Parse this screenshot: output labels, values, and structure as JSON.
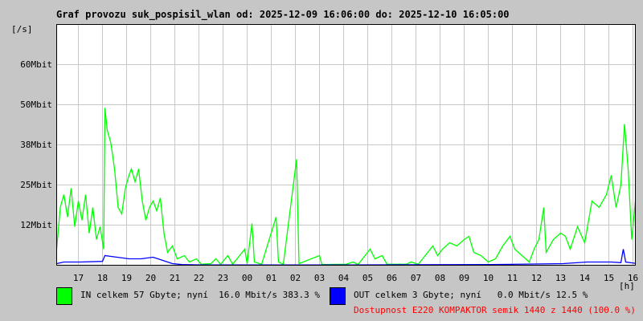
{
  "chart_data": {
    "type": "line",
    "title": "Graf provozu suk_pospisil_wlan od: 2025-12-09 16:06:00 do: 2025-12-10 16:05:00",
    "ylabel": "[/s]",
    "xlabel": "[h]",
    "ylim": [
      0,
      75
    ],
    "xlim_hours": [
      0,
      24
    ],
    "y_ticks": [
      {
        "v": 12.5,
        "label": "12Mbit"
      },
      {
        "v": 25,
        "label": "25Mbit"
      },
      {
        "v": 37.5,
        "label": "38Mbit"
      },
      {
        "v": 50,
        "label": "50Mbit"
      },
      {
        "v": 62.5,
        "label": "60Mbit"
      }
    ],
    "x_tick_labels": [
      "17",
      "18",
      "19",
      "20",
      "21",
      "22",
      "23",
      "00",
      "01",
      "02",
      "03",
      "04",
      "05",
      "06",
      "07",
      "08",
      "09",
      "10",
      "11",
      "12",
      "13",
      "14",
      "15",
      "16"
    ],
    "grid": true,
    "series": [
      {
        "name": "IN",
        "color": "#00ff00",
        "points": [
          [
            0,
            5
          ],
          [
            0.15,
            18
          ],
          [
            0.3,
            22
          ],
          [
            0.45,
            15
          ],
          [
            0.6,
            24
          ],
          [
            0.75,
            12
          ],
          [
            0.9,
            20
          ],
          [
            1.05,
            14
          ],
          [
            1.2,
            22
          ],
          [
            1.35,
            10
          ],
          [
            1.5,
            18
          ],
          [
            1.65,
            8
          ],
          [
            1.8,
            12
          ],
          [
            1.95,
            5
          ],
          [
            2.0,
            49
          ],
          [
            2.1,
            42
          ],
          [
            2.25,
            38
          ],
          [
            2.4,
            30
          ],
          [
            2.55,
            18
          ],
          [
            2.7,
            16
          ],
          [
            2.85,
            24
          ],
          [
            3.0,
            28
          ],
          [
            3.1,
            30
          ],
          [
            3.25,
            26
          ],
          [
            3.4,
            30
          ],
          [
            3.55,
            20
          ],
          [
            3.7,
            14
          ],
          [
            3.85,
            18
          ],
          [
            4.0,
            20
          ],
          [
            4.15,
            17
          ],
          [
            4.3,
            21
          ],
          [
            4.45,
            10
          ],
          [
            4.6,
            4
          ],
          [
            4.8,
            6
          ],
          [
            5.0,
            2
          ],
          [
            5.3,
            3
          ],
          [
            5.5,
            1
          ],
          [
            5.8,
            2
          ],
          [
            6.0,
            0.3
          ],
          [
            6.4,
            0.5
          ],
          [
            6.6,
            2
          ],
          [
            6.8,
            0.3
          ],
          [
            7.1,
            3
          ],
          [
            7.3,
            0.3
          ],
          [
            7.8,
            5
          ],
          [
            7.9,
            0.5
          ],
          [
            8.1,
            13
          ],
          [
            8.2,
            1
          ],
          [
            8.5,
            0.3
          ],
          [
            9.1,
            15
          ],
          [
            9.2,
            1
          ],
          [
            9.4,
            0.3
          ],
          [
            9.95,
            33
          ],
          [
            10.05,
            0.5
          ],
          [
            10.9,
            3
          ],
          [
            11.0,
            0.2
          ],
          [
            12.0,
            0.3
          ],
          [
            12.3,
            1
          ],
          [
            12.5,
            0.2
          ],
          [
            13.0,
            5
          ],
          [
            13.2,
            2
          ],
          [
            13.5,
            3
          ],
          [
            13.7,
            0.3
          ],
          [
            14.5,
            0.3
          ],
          [
            14.7,
            1
          ],
          [
            15.0,
            0.3
          ],
          [
            15.6,
            6
          ],
          [
            15.8,
            3
          ],
          [
            16.0,
            5
          ],
          [
            16.3,
            7
          ],
          [
            16.6,
            6
          ],
          [
            16.9,
            8
          ],
          [
            17.1,
            9
          ],
          [
            17.3,
            4
          ],
          [
            17.6,
            3
          ],
          [
            17.9,
            1
          ],
          [
            18.2,
            2
          ],
          [
            18.5,
            6
          ],
          [
            18.8,
            9
          ],
          [
            19.0,
            5
          ],
          [
            19.3,
            3
          ],
          [
            19.6,
            1
          ],
          [
            19.8,
            5
          ],
          [
            20.0,
            8
          ],
          [
            20.2,
            18
          ],
          [
            20.3,
            4
          ],
          [
            20.6,
            8
          ],
          [
            20.9,
            10
          ],
          [
            21.1,
            9
          ],
          [
            21.3,
            5
          ],
          [
            21.6,
            12
          ],
          [
            21.9,
            7
          ],
          [
            22.2,
            20
          ],
          [
            22.5,
            18
          ],
          [
            22.8,
            22
          ],
          [
            23.0,
            28
          ],
          [
            23.2,
            18
          ],
          [
            23.4,
            25
          ],
          [
            23.55,
            44
          ],
          [
            23.7,
            30
          ],
          [
            23.85,
            8
          ],
          [
            24,
            20
          ]
        ]
      },
      {
        "name": "OUT",
        "color": "#0000ff",
        "points": [
          [
            0,
            0.5
          ],
          [
            0.3,
            1
          ],
          [
            1.0,
            1
          ],
          [
            1.9,
            1.2
          ],
          [
            2.0,
            3
          ],
          [
            2.5,
            2.5
          ],
          [
            3.0,
            2
          ],
          [
            3.5,
            2
          ],
          [
            4.0,
            2.5
          ],
          [
            4.4,
            1.5
          ],
          [
            4.8,
            0.5
          ],
          [
            5.2,
            0.2
          ],
          [
            6,
            0.1
          ],
          [
            12,
            0.1
          ],
          [
            18,
            0.2
          ],
          [
            21,
            0.5
          ],
          [
            22,
            1
          ],
          [
            23,
            1
          ],
          [
            23.4,
            0.8
          ],
          [
            23.5,
            5
          ],
          [
            23.6,
            1
          ],
          [
            24,
            0.6
          ]
        ]
      }
    ]
  },
  "legend": {
    "in_text": "IN celkem 57 Gbyte; nyní  16.0 Mbit/s 383.3 %",
    "out_text": "OUT celkem 3 Gbyte; nyní   0.0 Mbit/s 12.5 %",
    "availability": "Dostupnost E220 KOMPAKTOR semik 1440 z 1440 (100.0 %)",
    "in_color": "#00ff00",
    "out_color": "#0000ff",
    "availability_color": "#ff0000"
  }
}
